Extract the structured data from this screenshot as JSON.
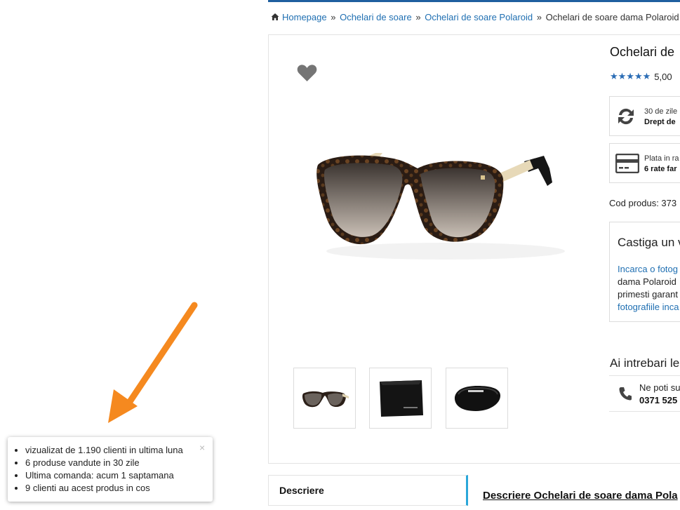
{
  "breadcrumb": {
    "items": [
      "Homepage",
      "Ochelari de soare",
      "Ochelari de soare Polaroid"
    ],
    "current": "Ochelari de soare dama Polaroid",
    "separator": "»"
  },
  "product": {
    "title": "Ochelari de",
    "rating_value": "5,00",
    "stars": "★★★★★",
    "rating_stars_count": 5,
    "cod_produs": "Cod produs: 373"
  },
  "info_boxes": {
    "returns": {
      "line1": "30 de zile",
      "line2": "Drept de"
    },
    "installments": {
      "line1": "Plata in ra",
      "line2": "6 rate far"
    }
  },
  "win_box": {
    "title": "Castiga un v",
    "line1": "Incarca o fotog",
    "line2": "dama Polaroid",
    "line3": "primesti garant",
    "line4": "fotografiile inca"
  },
  "questions": {
    "title": "Ai intrebari le",
    "line1": "Ne poti su",
    "phone": "0371 525"
  },
  "tabs": {
    "descriere": "Descriere"
  },
  "description": {
    "heading": "Descriere Ochelari de soare dama Pola"
  },
  "stats_popup": {
    "items": [
      "vizualizat de 1.190 clienti in ultima luna",
      "6 produse vandute in 30 zile",
      "Ultima comanda: acum 1 saptamana",
      "9 clienti au acest produs in cos"
    ],
    "close": "×"
  },
  "colors": {
    "link": "#1f6fb2",
    "accent_bar": "#1f5f9f",
    "tab_accent": "#2aa7d9",
    "star": "#2a6cb5",
    "arrow": "#f5891f"
  },
  "icons": [
    "home-icon",
    "heart-icon",
    "refresh-icon",
    "credit-card-icon",
    "phone-icon",
    "close-icon"
  ]
}
